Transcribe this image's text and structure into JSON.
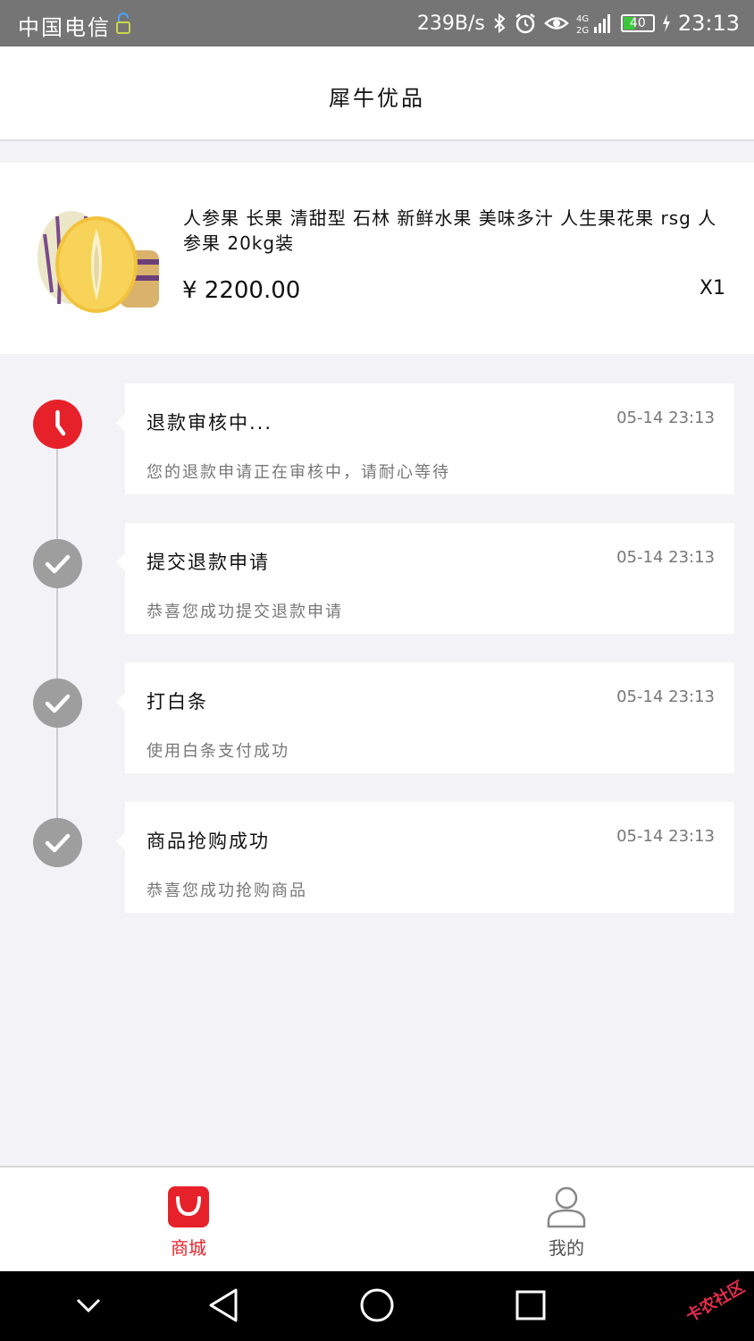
{
  "status_bar": {
    "carrier": "中国电信",
    "network_speed": "239B/s",
    "battery": "40",
    "time": "23:13",
    "network_type": "4G"
  },
  "header": {
    "title": "犀牛优品"
  },
  "product": {
    "name": "人参果 长果 清甜型 石林 新鲜水果 美味多汁 人生果花果 rsg 人参果 20kg装",
    "price": "¥ 2200.00",
    "quantity": "X1"
  },
  "timeline": [
    {
      "title": "退款审核中...",
      "time": "05-14 23:13",
      "desc": "您的退款申请正在审核中，请耐心等待",
      "status": "pending",
      "icon": "clock-icon"
    },
    {
      "title": "提交退款申请",
      "time": "05-14 23:13",
      "desc": "恭喜您成功提交退款申请",
      "status": "done",
      "icon": "check-icon"
    },
    {
      "title": "打白条",
      "time": "05-14 23:13",
      "desc": "使用白条支付成功",
      "status": "done",
      "icon": "check-icon"
    },
    {
      "title": "商品抢购成功",
      "time": "05-14 23:13",
      "desc": "恭喜您成功抢购商品",
      "status": "done",
      "icon": "check-icon"
    }
  ],
  "tabs": [
    {
      "label": "商城",
      "icon": "shopping-bag-icon",
      "active": true
    },
    {
      "label": "我的",
      "icon": "user-icon",
      "active": false
    }
  ],
  "colors": {
    "accent": "#e62129",
    "done": "#9e9e9e",
    "background": "#f3f3f7"
  },
  "watermark": "卡农社区"
}
